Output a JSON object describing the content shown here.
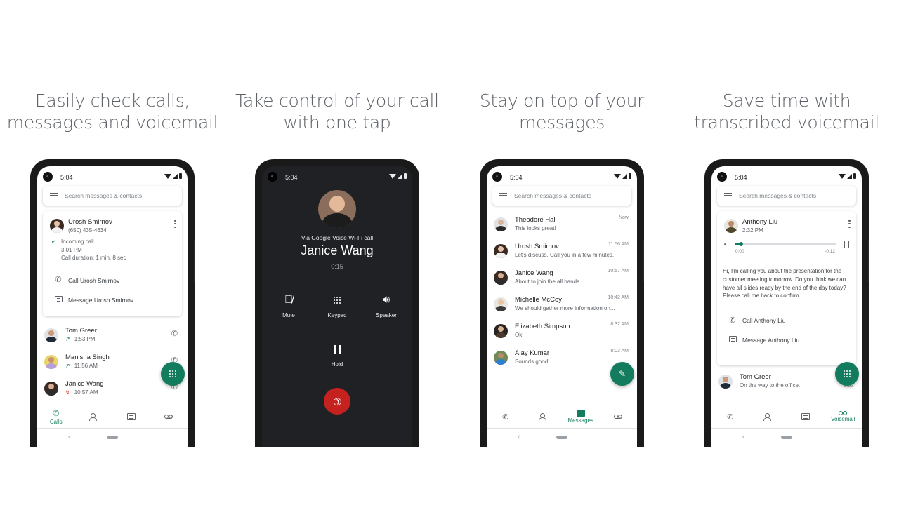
{
  "status_time": "5:04",
  "search_placeholder": "Search messages & contacts",
  "colors": {
    "accent": "#137c5e",
    "end_call": "#c5221f",
    "dark_bg": "#202124"
  },
  "panels": [
    {
      "headline_line1": "Easily check calls,",
      "headline_line2": "messages and voicemail",
      "detail_card": {
        "name": "Urosh Smirnov",
        "phone": "(650) 435-4634",
        "call_type": "Incoming call",
        "call_time": "3:01 PM",
        "call_duration": "Call duration: 1 min, 8 sec",
        "actions": [
          "Call Urosh Smirnov",
          "Message Urosh Smirnov"
        ]
      },
      "calls": [
        {
          "name": "Tom Greer",
          "time": "1:53 PM",
          "direction": "outgoing-icon"
        },
        {
          "name": "Manisha Singh",
          "time": "11:56 AM",
          "direction": "outgoing-icon"
        },
        {
          "name": "Janice Wang",
          "time": "10:57 AM",
          "direction": "missed-icon"
        }
      ],
      "nav": [
        {
          "label": "Calls",
          "icon": "phone-icon",
          "active": true
        },
        {
          "label": "",
          "icon": "contacts-icon",
          "active": false
        },
        {
          "label": "",
          "icon": "message-icon",
          "active": false
        },
        {
          "label": "",
          "icon": "voicemail-icon",
          "active": false
        }
      ]
    },
    {
      "headline_line1": "Take control of your call",
      "headline_line2": "with one tap",
      "via": "Via Google Voice Wi-Fi call",
      "callee": "Janice Wang",
      "duration": "0:15",
      "buttons": {
        "mute": "Mute",
        "keypad": "Keypad",
        "speaker": "Speaker",
        "hold": "Hold"
      }
    },
    {
      "headline_line1": "Stay on top of your",
      "headline_line2": "messages",
      "messages": [
        {
          "name": "Theodore Hall",
          "preview": "This looks great!",
          "time": "Now"
        },
        {
          "name": "Urosh Smirnov",
          "preview": "Let's discuss. Call you in a few minutes.",
          "time": "11:56 AM"
        },
        {
          "name": "Janice Wang",
          "preview": "About to join the all hands.",
          "time": "10:57 AM"
        },
        {
          "name": "Michelle McCoy",
          "preview": "We should gather more information on...",
          "time": "10:42 AM"
        },
        {
          "name": "Elizabeth Simpson",
          "preview": "Ok!",
          "time": "8:32 AM"
        },
        {
          "name": "Ajay Kumar",
          "preview": "Sounds good!",
          "time": "8:03 AM"
        }
      ],
      "nav": [
        {
          "label": "",
          "icon": "phone-icon",
          "active": false
        },
        {
          "label": "",
          "icon": "contacts-icon",
          "active": false
        },
        {
          "label": "Messages",
          "icon": "message-icon",
          "active": true
        },
        {
          "label": "",
          "icon": "voicemail-icon",
          "active": false
        }
      ]
    },
    {
      "headline_line1": "Save time with",
      "headline_line2": "transcribed voicemail",
      "voicemail": {
        "name": "Anthony Liu",
        "time": "2:32 PM",
        "elapsed": "0:00",
        "remaining": "-0:12",
        "progress_percent": 6,
        "transcript": "Hi, I'm calling you about the presentation for the customer meeting tomorrow. Do you think we can have all slides ready by the end of the day today? Please call me back to confirm.",
        "actions": [
          "Call Anthony Liu",
          "Message Anthony Liu"
        ]
      },
      "next": {
        "name": "Tom Greer",
        "preview": "On the way to the office.",
        "duration": "0:02"
      },
      "nav": [
        {
          "label": "",
          "icon": "phone-icon",
          "active": false
        },
        {
          "label": "",
          "icon": "contacts-icon",
          "active": false
        },
        {
          "label": "",
          "icon": "message-icon",
          "active": false
        },
        {
          "label": "Voicemail",
          "icon": "voicemail-icon",
          "active": true
        }
      ]
    }
  ]
}
